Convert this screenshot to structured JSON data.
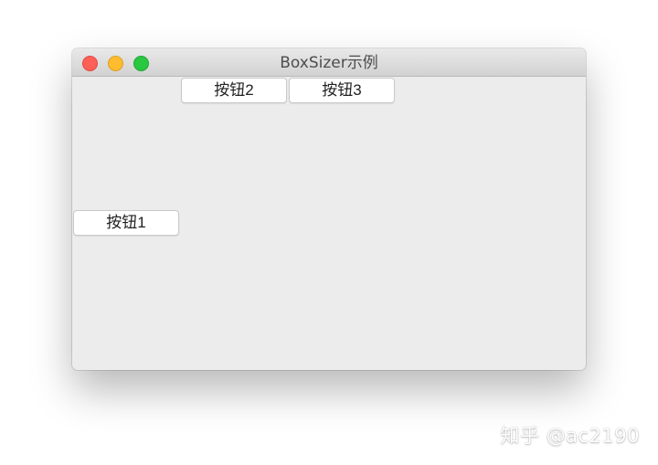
{
  "window": {
    "title": "BoxSizer示例",
    "traffic_lights": {
      "close_color": "#fe5f57",
      "minimize_color": "#febc2e",
      "maximize_color": "#28c840"
    }
  },
  "buttons": {
    "button1_label": "按钮1",
    "button2_label": "按钮2",
    "button3_label": "按钮3"
  },
  "watermark": {
    "text": "知乎 @ac2190"
  }
}
